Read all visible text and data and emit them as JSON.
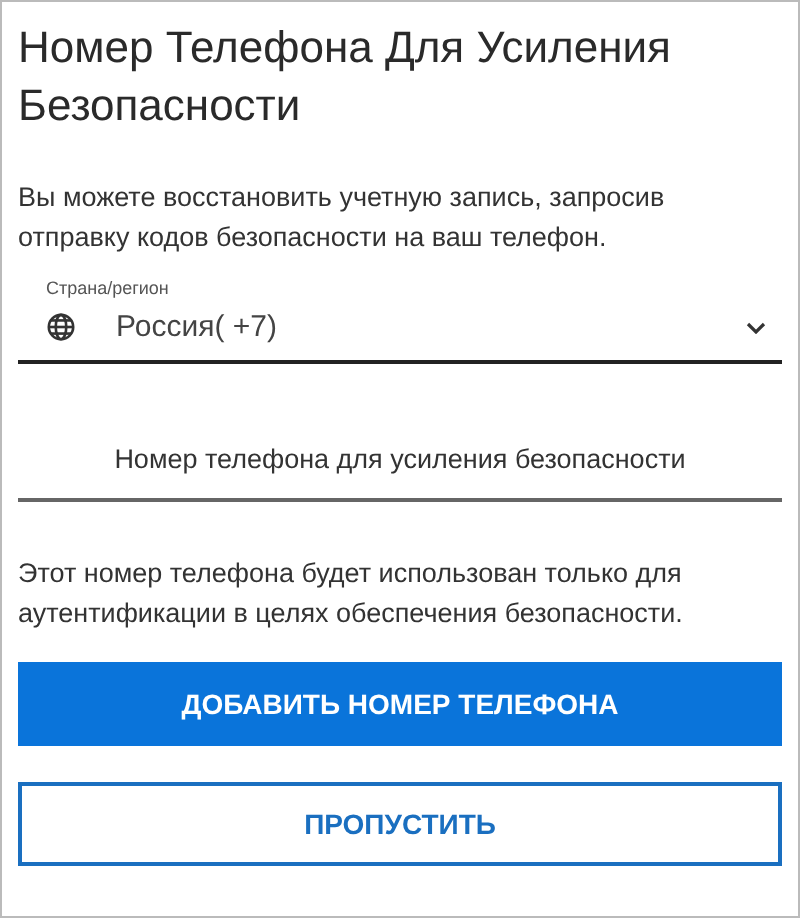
{
  "title": "Номер Телефона Для Усиления Безопасности",
  "description": "Вы можете восстановить учетную запись, запросив отправку кодов безопасности на ваш телефон.",
  "country_field": {
    "label": "Страна/регион",
    "value": "Россия( +7)"
  },
  "phone_field": {
    "placeholder": "Номер телефона для усиления безопасности"
  },
  "note": "Этот номер телефона будет использован только для аутентификации в целях обеспечения безопасности.",
  "buttons": [
    {
      "label": "ДОБАВИТЬ НОМЕР ТЕЛЕФОНА",
      "kind": "primary"
    },
    {
      "label": "ПРОПУСТИТЬ",
      "kind": "secondary"
    }
  ]
}
